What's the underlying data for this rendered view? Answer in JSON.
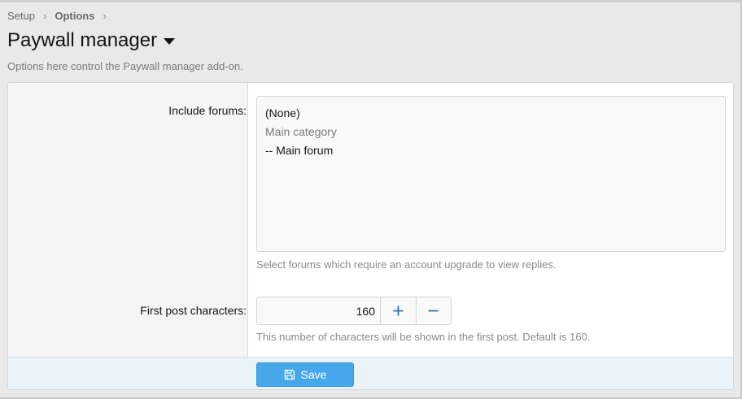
{
  "breadcrumb": {
    "items": [
      "Setup",
      "Options"
    ]
  },
  "page": {
    "title": "Paywall manager",
    "description": "Options here control the Paywall manager add-on."
  },
  "options": {
    "include_forums": {
      "label": "Include forums:",
      "list": [
        "(None)",
        "Main category",
        "-- Main forum"
      ],
      "hint": "Select forums which require an account upgrade to view replies."
    },
    "first_post_chars": {
      "label": "First post characters:",
      "value": "160",
      "increment_icon": "plus-icon",
      "decrement_icon": "minus-icon",
      "hint": "This number of characters will be shown in the first post. Default is 160."
    }
  },
  "footer": {
    "save_label": "Save",
    "save_icon": "save-icon"
  },
  "colors": {
    "accent": "#47a7eb",
    "stepper_icon": "#2577b1",
    "footer_bg": "#eaf3f9"
  }
}
